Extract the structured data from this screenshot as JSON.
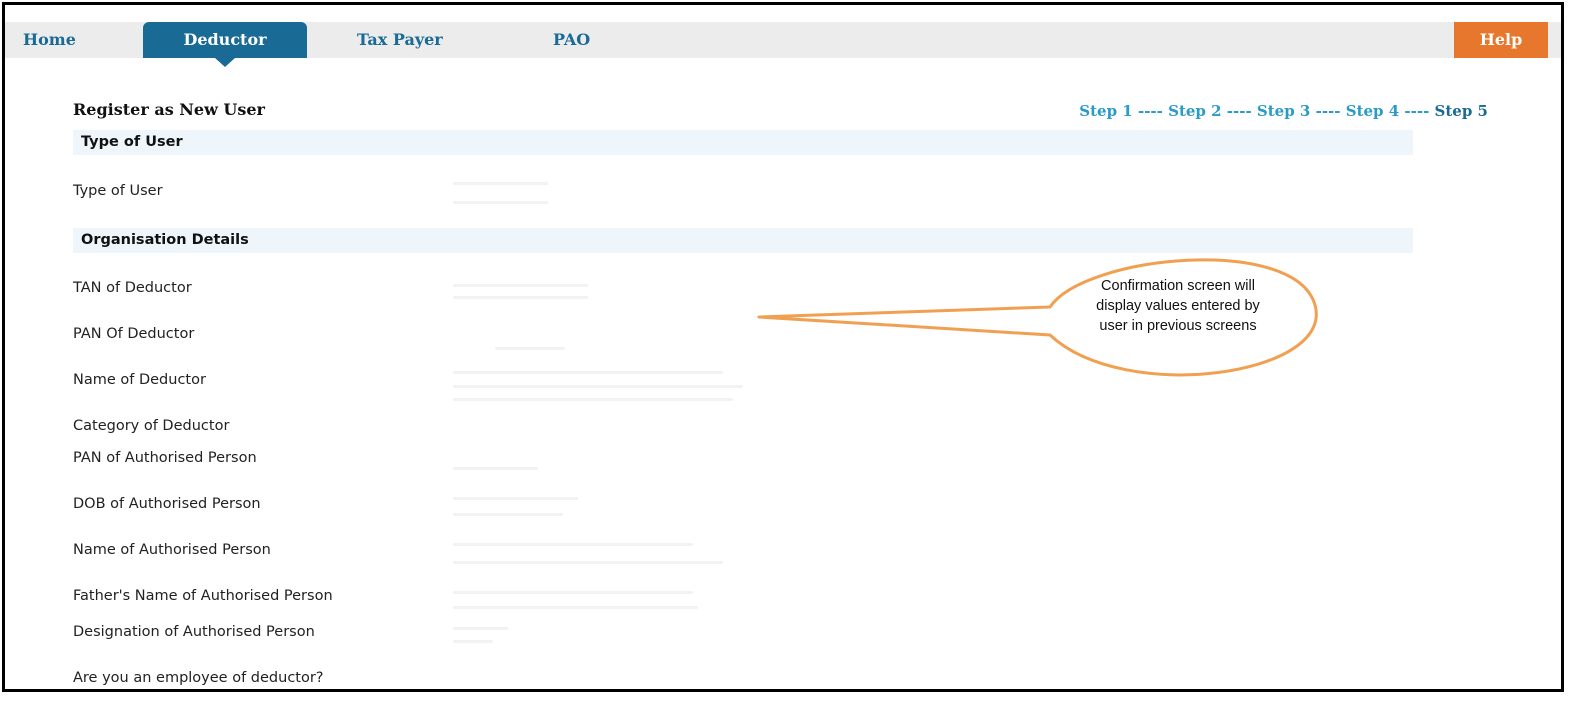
{
  "nav": {
    "home": "Home",
    "deductor": "Deductor",
    "tax_payer": "Tax Payer",
    "pao": "PAO",
    "help": "Help"
  },
  "page": {
    "title": "Register as New User",
    "steps": {
      "step1": "Step 1",
      "step2": "Step 2",
      "step3": "Step 3",
      "step4": "Step 4",
      "step5": "Step 5",
      "separator": " ---- "
    }
  },
  "sections": {
    "type_of_user": "Type of User",
    "organisation_details": "Organisation Details"
  },
  "fields": {
    "type_of_user": "Type of User",
    "tan_of_deductor": "TAN of Deductor",
    "pan_of_deductor": "PAN Of Deductor",
    "name_of_deductor": "Name of Deductor",
    "category_of_deductor": "Category of Deductor",
    "pan_of_authorised_person": "PAN of Authorised Person",
    "dob_of_authorised_person": "DOB of Authorised Person",
    "name_of_authorised_person": "Name of Authorised Person",
    "fathers_name_of_authorised_person": "Father's Name of Authorised Person",
    "designation_of_authorised_person": "Designation of Authorised Person",
    "employee_of_deductor": "Are you an employee of deductor?"
  },
  "callout": {
    "text": "Confirmation screen will display values entered by user in previous screens",
    "border_color": "#f0a050"
  },
  "colors": {
    "nav_active": "#1a6a96",
    "help": "#e8772e",
    "step_link": "#2a9ac8",
    "section_bg": "#eef5fb"
  }
}
